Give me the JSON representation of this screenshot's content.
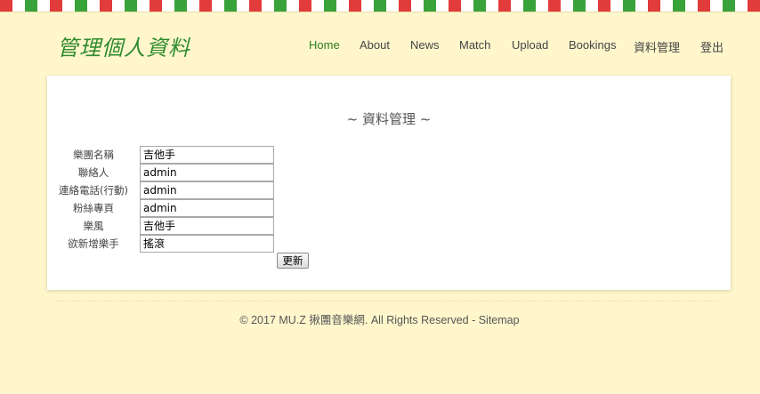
{
  "site_title": "管理個人資料",
  "nav": [
    {
      "label": "Home",
      "active": true
    },
    {
      "label": "About"
    },
    {
      "label": "News"
    },
    {
      "label": "Match"
    },
    {
      "label": "Upload"
    },
    {
      "label": "Bookings"
    },
    {
      "label": "資料管理"
    },
    {
      "label": "登出"
    }
  ],
  "panel": {
    "title": "~ 資料管理 ~",
    "fields": [
      {
        "label": "樂團名稱",
        "value": "吉他手"
      },
      {
        "label": "聯絡人",
        "value": "admin"
      },
      {
        "label": "連絡電話(行動)",
        "value": "admin"
      },
      {
        "label": "粉絲專頁",
        "value": "admin"
      },
      {
        "label": "樂風",
        "value": "吉他手"
      },
      {
        "label": "欲新增樂手",
        "value": "搖滾"
      }
    ],
    "submit_label": "更新"
  },
  "footer": "© 2017 MU.Z 揪團音樂網. All Rights Reserved - Sitemap",
  "colors": {
    "background": "#fff6cc",
    "title_green": "#2e8b2e",
    "nav_active": "#2e7d1e",
    "stripe_red": "#e23b3b",
    "stripe_green": "#3aa23a"
  }
}
